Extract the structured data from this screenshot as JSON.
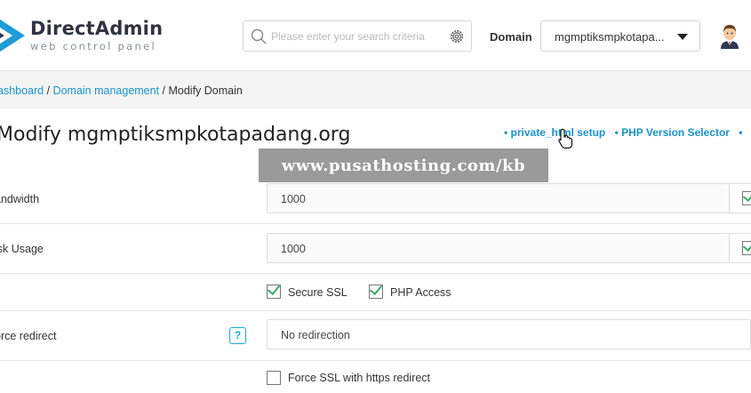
{
  "brand": {
    "name": "DirectAdmin",
    "tagline": "web control panel"
  },
  "search": {
    "placeholder": "Please enter your search criteria"
  },
  "header": {
    "domain_label": "Domain",
    "domain_value": "mgmptiksmpkotapa..."
  },
  "breadcrumb": {
    "item1": "ashboard",
    "sep": " / ",
    "item2": "Domain management",
    "current": "Modify Domain"
  },
  "page": {
    "title": "Modify mgmptiksmpkotapadang.org"
  },
  "top_links": [
    "• private_html setup",
    "• PHP Version Selector",
    "•"
  ],
  "watermark": "www.pusathosting.com/kb",
  "form": {
    "bandwidth": {
      "label": "andwidth",
      "value": "1000"
    },
    "disk": {
      "label": "isk Usage",
      "value": "1000"
    },
    "secure_ssl": {
      "label": "Secure SSL",
      "checked": true
    },
    "php_access": {
      "label": "PHP Access",
      "checked": true
    },
    "force_redirect": {
      "label": "orce redirect",
      "help": "?",
      "value": "No redirection"
    },
    "force_ssl": {
      "label": "Force SSL with https redirect",
      "checked": false
    }
  },
  "colors": {
    "link": "#1a92c8",
    "accent": "#1aa9d6",
    "check": "#3aa86b",
    "watermark_bg": "#9a9a9a"
  },
  "icons": [
    "directadmin-logo-icon",
    "search-icon",
    "gear-icon",
    "chevron-down-icon",
    "avatar-icon",
    "hand-cursor-icon",
    "checkbox-icon",
    "help-icon"
  ]
}
